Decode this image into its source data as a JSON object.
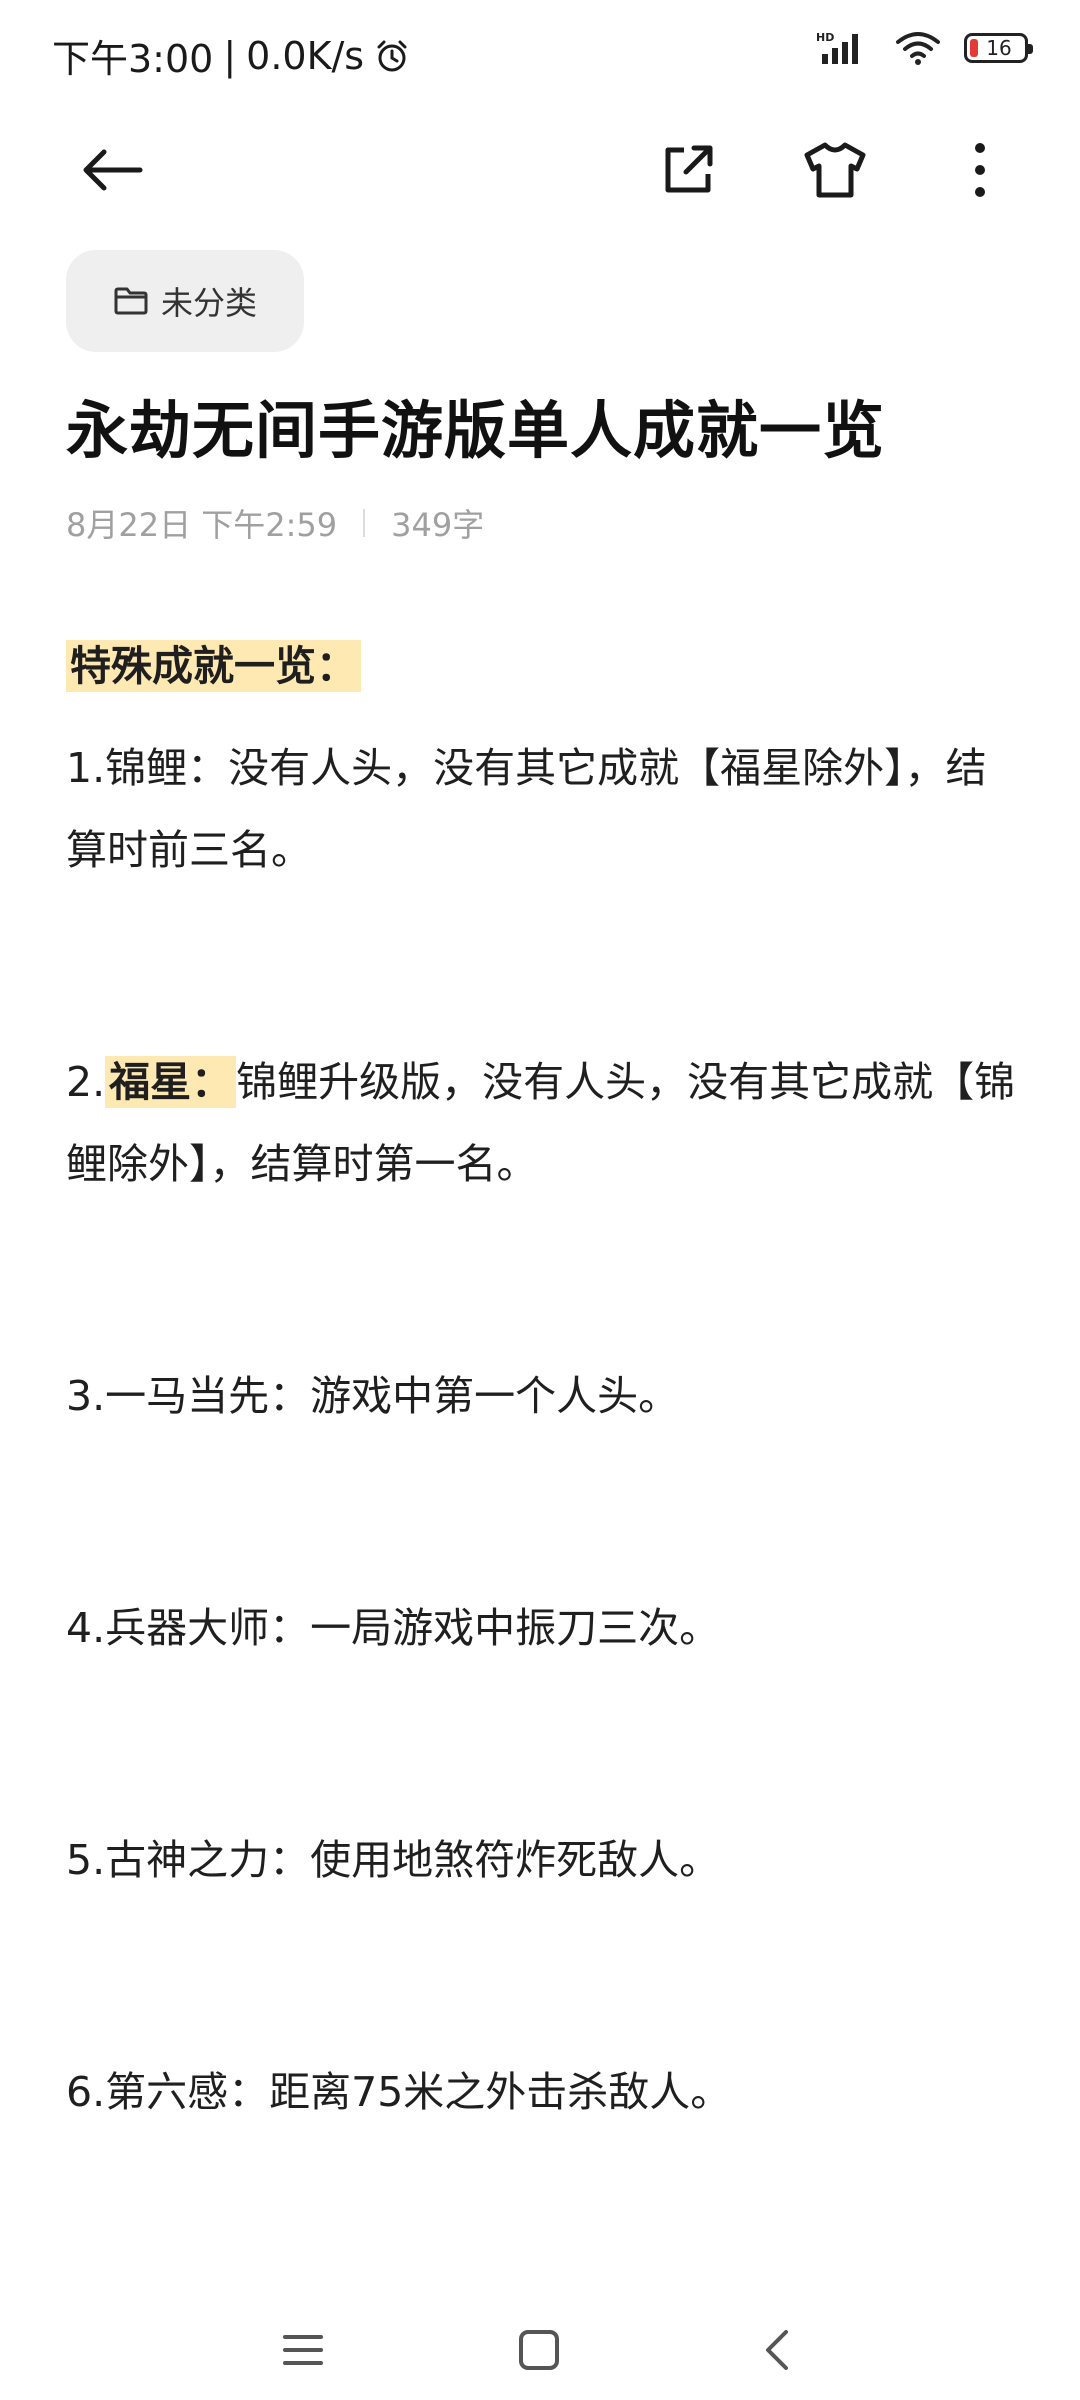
{
  "status_bar": {
    "time": "下午3:00",
    "separator": "|",
    "speed": "0.0K/s",
    "network_label": "HD",
    "battery_level": "16"
  },
  "toolbar": {
    "back_icon": "arrow-left-icon",
    "share_icon": "external-share-icon",
    "theme_icon": "tshirt-icon",
    "more_icon": "more-vertical-icon"
  },
  "category": {
    "label": "未分类",
    "icon": "folder-icon"
  },
  "note": {
    "title": "永劫无间手游版单人成就一览",
    "date": "8月22日 下午2:59",
    "word_count": "349字"
  },
  "content": {
    "heading": "特殊成就一览：",
    "items": [
      {
        "prefix": "1.锦鲤",
        "text": "：没有人头，没有其它成就【福星除外】，结算时前三名。"
      },
      {
        "prefix": "2.",
        "highlight": "福星：",
        "text": "锦鲤升级版，没有人头，没有其它成就【锦鲤除外】，结算时第一名。"
      },
      {
        "prefix": "3.一马当先",
        "text": "：游戏中第一个人头。"
      },
      {
        "prefix": "4.兵器大师",
        "text": "：一局游戏中振刀三次。"
      },
      {
        "prefix": "5.古神之力",
        "text": "：使用地煞符炸死敌人。"
      },
      {
        "prefix": "6.第六感",
        "text": "：距离75米之外击杀敌人。"
      }
    ]
  },
  "nav_bar": {
    "menu_icon": "menu-icon",
    "home_icon": "home-square-icon",
    "back_icon": "chevron-left-icon"
  }
}
